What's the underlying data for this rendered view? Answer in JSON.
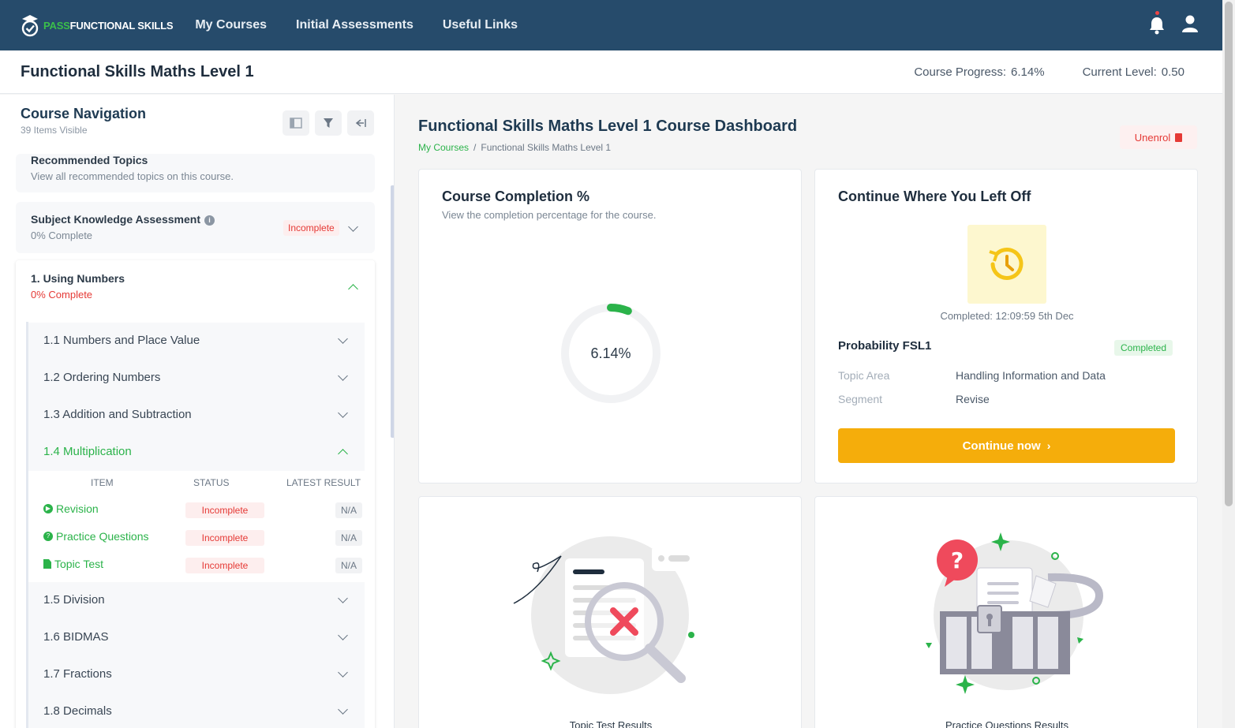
{
  "nav": {
    "logo_pass": "PASS",
    "logo_rest": "FUNCTIONAL SKILLS",
    "links": [
      "My Courses",
      "Initial Assessments",
      "Useful Links"
    ]
  },
  "header": {
    "title": "Functional Skills Maths Level 1",
    "progress_label": "Course Progress:",
    "progress_value": "6.14%",
    "level_label": "Current Level:",
    "level_value": "0.50"
  },
  "sidebar": {
    "title": "Course Navigation",
    "subtitle": "39 Items Visible",
    "recommended": {
      "title": "Recommended Topics",
      "subtitle": "View all recommended topics on this course."
    },
    "ska": {
      "title": "Subject Knowledge Assessment",
      "subtitle": "0% Complete",
      "status": "Incomplete"
    },
    "unit": {
      "title": "1. Using Numbers",
      "subtitle": "0% Complete"
    },
    "topics": [
      "1.1 Numbers and Place Value",
      "1.2 Ordering Numbers",
      "1.3 Addition and Subtraction",
      "1.4 Multiplication",
      "1.5 Division",
      "1.6 BIDMAS",
      "1.7 Fractions",
      "1.8 Decimals"
    ],
    "table": {
      "headers": [
        "ITEM",
        "STATUS",
        "LATEST RESULT"
      ],
      "rows": [
        {
          "item": "Revision",
          "status": "Incomplete",
          "result": "N/A"
        },
        {
          "item": "Practice Questions",
          "status": "Incomplete",
          "result": "N/A"
        },
        {
          "item": "Topic Test",
          "status": "Incomplete",
          "result": "N/A"
        }
      ]
    }
  },
  "main": {
    "title": "Functional Skills Maths Level 1 Course Dashboard",
    "breadcrumb_home": "My Courses",
    "breadcrumb_sep": "/",
    "breadcrumb_current": "Functional Skills Maths Level 1",
    "unenrol": "Unenrol",
    "completion": {
      "title": "Course Completion %",
      "subtitle": "View the completion percentage for the course.",
      "value_label": "6.14%",
      "fraction": 0.0614
    },
    "continue": {
      "title": "Continue Where You Left Off",
      "completed_time": "Completed: 12:09:59 5th Dec",
      "activity": "Probability FSL1",
      "badge": "Completed",
      "topic_area_label": "Topic Area",
      "topic_area_value": "Handling Information and Data",
      "segment_label": "Segment",
      "segment_value": "Revise",
      "button": "Continue now"
    },
    "topic_results_caption": "Topic Test Results",
    "practice_results_caption": "Practice Questions Results"
  },
  "colors": {
    "nav_bg": "#264b6b",
    "accent_green": "#2bb34a",
    "danger_red": "#e53935",
    "button_orange": "#f5ad0b"
  }
}
